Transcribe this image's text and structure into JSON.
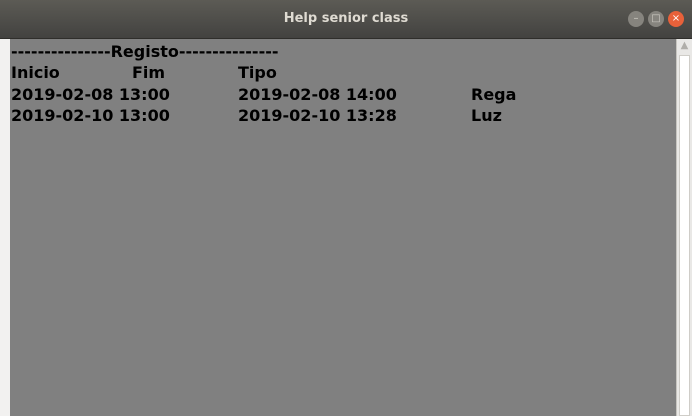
{
  "window": {
    "title": "Help senior class",
    "controls": {
      "minimize_icon": "minimize-icon",
      "maximize_icon": "maximize-icon",
      "close_icon": "close-icon"
    }
  },
  "log": {
    "header": "---------------Registo---------------",
    "columns": [
      "Inicio",
      "Fim",
      "Tipo"
    ],
    "rows": [
      {
        "start": "2019-02-08 13:00",
        "end": "2019-02-08 14:00",
        "type": "Rega"
      },
      {
        "start": "2019-02-10 13:00",
        "end": "2019-02-10 13:28",
        "type": "Luz"
      }
    ]
  },
  "colors": {
    "titlebar": "#4a4945",
    "content_bg": "#808080",
    "close_button": "#e8613a",
    "text": "#000000"
  }
}
